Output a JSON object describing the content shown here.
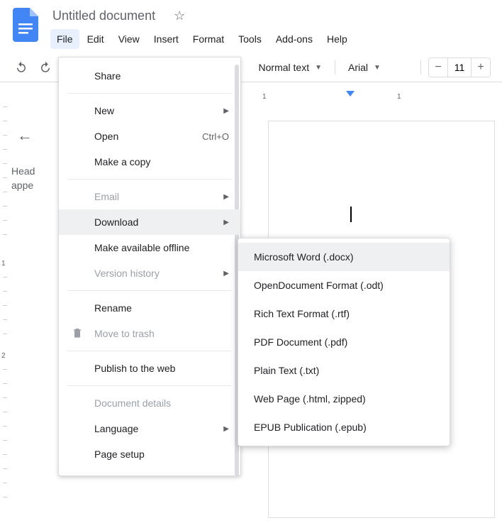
{
  "title": "Untitled document",
  "menus": {
    "file": "File",
    "edit": "Edit",
    "view": "View",
    "insert": "Insert",
    "format": "Format",
    "tools": "Tools",
    "addons": "Add-ons",
    "help": "Help"
  },
  "toolbar": {
    "style": "Normal text",
    "font": "Arial",
    "size": "11"
  },
  "ruler": {
    "n1": "1",
    "n2": "2"
  },
  "outline": {
    "hint_l1": "Head",
    "hint_l2": "appe"
  },
  "file_menu": {
    "share": "Share",
    "new": "New",
    "open": "Open",
    "open_shortcut": "Ctrl+O",
    "copy": "Make a copy",
    "email": "Email",
    "download": "Download",
    "offline": "Make available offline",
    "history": "Version history",
    "rename": "Rename",
    "trash": "Move to trash",
    "publish": "Publish to the web",
    "details": "Document details",
    "language": "Language",
    "pagesetup": "Page setup"
  },
  "download_menu": {
    "docx": "Microsoft Word (.docx)",
    "odt": "OpenDocument Format (.odt)",
    "rtf": "Rich Text Format (.rtf)",
    "pdf": "PDF Document (.pdf)",
    "txt": "Plain Text (.txt)",
    "html": "Web Page (.html, zipped)",
    "epub": "EPUB Publication (.epub)"
  }
}
